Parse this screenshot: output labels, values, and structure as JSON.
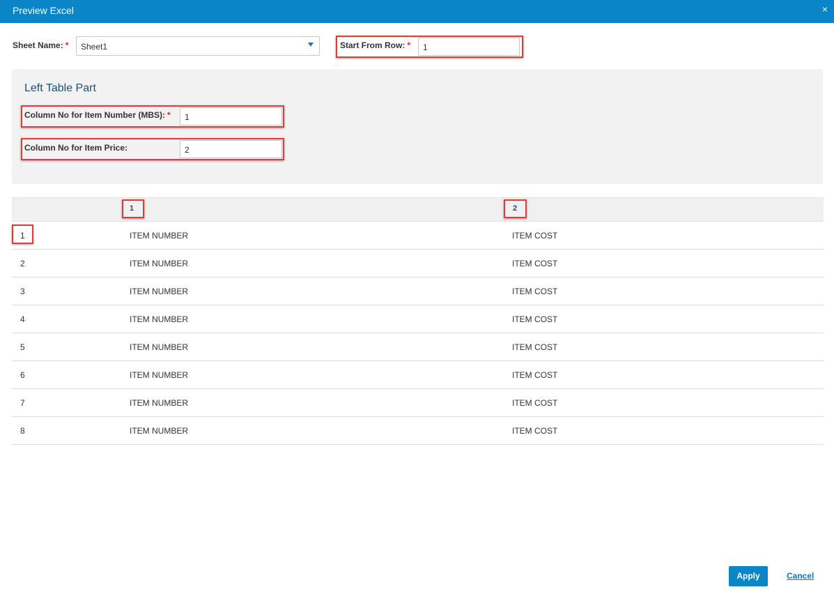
{
  "dialog": {
    "title": "Preview Excel",
    "close_glyph": "×"
  },
  "form": {
    "sheet_name_label": "Sheet Name:",
    "sheet_name_value": "Sheet1",
    "start_row_label": "Start From Row:",
    "start_row_value": "1",
    "required_mark": "*"
  },
  "panel": {
    "title": "Left Table Part",
    "item_number_col_label": "Column No for Item Number (MBS):",
    "item_number_col_value": "1",
    "item_price_col_label": "Column No for Item Price:",
    "item_price_col_value": "2"
  },
  "table": {
    "columns": [
      "",
      "1",
      "2"
    ],
    "rows": [
      [
        "1",
        "ITEM NUMBER",
        "ITEM COST"
      ],
      [
        "2",
        "ITEM NUMBER",
        "ITEM COST"
      ],
      [
        "3",
        "ITEM NUMBER",
        "ITEM COST"
      ],
      [
        "4",
        "ITEM NUMBER",
        "ITEM COST"
      ],
      [
        "5",
        "ITEM NUMBER",
        "ITEM COST"
      ],
      [
        "6",
        "ITEM NUMBER",
        "ITEM COST"
      ],
      [
        "7",
        "ITEM NUMBER",
        "ITEM COST"
      ],
      [
        "8",
        "ITEM NUMBER",
        "ITEM COST"
      ]
    ]
  },
  "footer": {
    "apply_label": "Apply",
    "cancel_label": "Cancel"
  },
  "colors": {
    "accent": "#0a86c8",
    "highlight": "#e53935",
    "required": "#d9232d",
    "panel_bg": "#f2f2f2"
  },
  "icons": {
    "close": "close-icon",
    "dropdown": "chevron-down-icon"
  }
}
